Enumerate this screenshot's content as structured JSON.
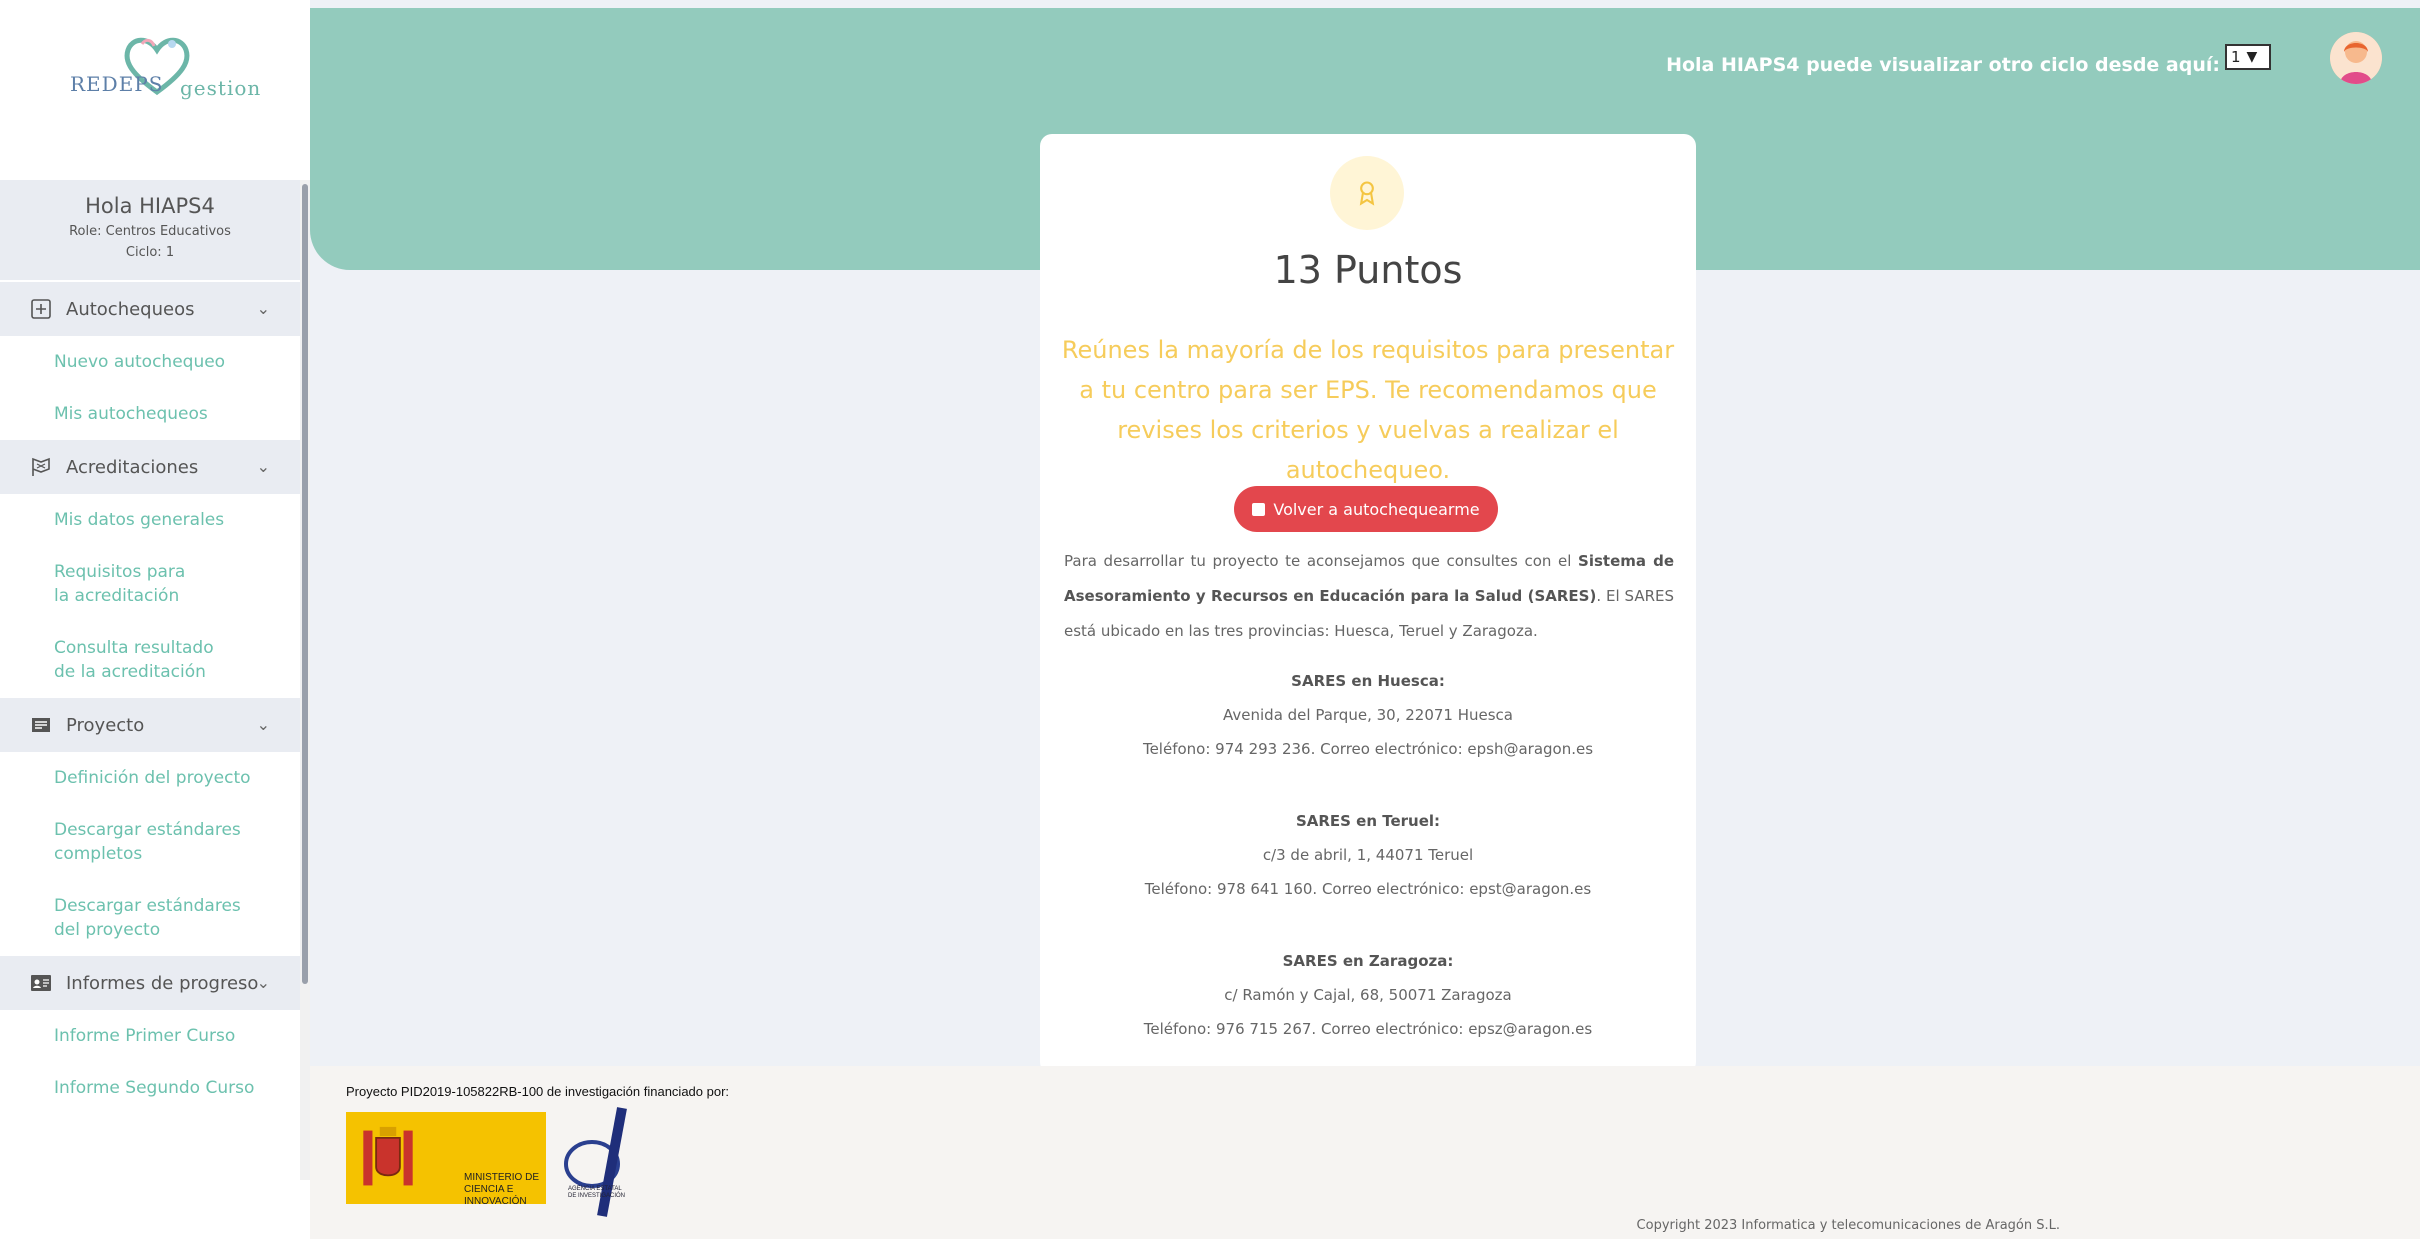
{
  "sidebar": {
    "logo": {
      "part1": "REDEPS",
      "part2": "gestion"
    },
    "user": {
      "greeting": "Hola HIAPS4",
      "role": "Role: Centros Educativos",
      "cycle": "Ciclo: 1"
    },
    "sections": [
      {
        "label": "Autochequeos",
        "icon": "plus-square-icon",
        "links": [
          "Nuevo autochequeo",
          "Mis autochequeos"
        ]
      },
      {
        "label": "Acreditaciones",
        "icon": "flags-icon",
        "links": [
          "Mis datos generales",
          "Requisitos para\nla acreditación",
          "Consulta resultado\nde la acreditación"
        ]
      },
      {
        "label": "Proyecto",
        "icon": "project-icon",
        "links": [
          "Definición del proyecto",
          "Descargar estándares\ncompletos",
          "Descargar estándares\ndel proyecto"
        ]
      },
      {
        "label": "Informes de progreso",
        "icon": "id-card-icon",
        "links": [
          "Informe Primer Curso",
          "Informe Segundo Curso"
        ]
      }
    ]
  },
  "header": {
    "cycle_prompt": "Hola HIAPS4 puede visualizar otro ciclo desde aquí:",
    "cycle_value": "1"
  },
  "result": {
    "points": "13 Puntos",
    "message": "Reúnes la mayoría de los requisitos para presentar a tu centro para ser EPS. Te recomendamos que revises los criterios y vuelvas a realizar el autochequeo.",
    "retry_label": "Volver a autochequearme",
    "intro_before": "Para desarrollar tu proyecto te aconsejamos que consultes con el ",
    "intro_bold": "Sistema de Asesoramiento y Recursos en Educación para la Salud (SARES)",
    "intro_after": ". El SARES está ubicado en las tres provincias: Huesca, Teruel y Zaragoza.",
    "offices": [
      {
        "name": "SARES en Huesca:",
        "address": "Avenida del Parque, 30, 22071 Huesca",
        "contact": "Teléfono: 974 293 236. Correo electrónico: epsh@aragon.es"
      },
      {
        "name": "SARES en Teruel:",
        "address": "c/3 de abril, 1, 44071 Teruel",
        "contact": "Teléfono: 978 641 160. Correo electrónico: epst@aragon.es"
      },
      {
        "name": "SARES en Zaragoza:",
        "address": "c/ Ramón y Cajal, 68, 50071 Zaragoza",
        "contact": "Teléfono: 976 715 267. Correo electrónico: epsz@aragon.es"
      }
    ]
  },
  "footer": {
    "funding": "Proyecto PID2019-105822RB-100 de investigación financiado por:",
    "ministry": "MINISTERIO DE CIENCIA E INNOVACIÓN",
    "agency": "AGENCIA ESTATAL DE INVESTIGACIÓN",
    "copyright": "Copyright 2023 Informatica y telecomunicaciones de Aragón S.L."
  },
  "colors": {
    "header": "#93cbbd",
    "link": "#6cc1ae",
    "message": "#f6cc5b",
    "button": "#e3474d"
  }
}
